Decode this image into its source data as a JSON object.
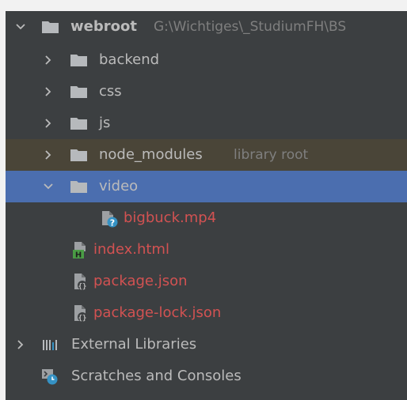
{
  "tree": {
    "root": {
      "name": "webroot",
      "path": "G:\\Wichtiges\\_StudiumFH\\BS",
      "expanded": true,
      "icon": "folder-icon"
    },
    "items": [
      {
        "name": "backend",
        "type": "folder",
        "expanded": false,
        "icon": "folder-icon"
      },
      {
        "name": "css",
        "type": "folder",
        "expanded": false,
        "icon": "folder-icon"
      },
      {
        "name": "js",
        "type": "folder",
        "expanded": false,
        "icon": "folder-icon"
      },
      {
        "name": "node_modules",
        "type": "folder",
        "expanded": false,
        "hint": "library root",
        "icon": "folder-icon"
      },
      {
        "name": "video",
        "type": "folder",
        "expanded": true,
        "selected": true,
        "icon": "folder-icon"
      },
      {
        "name": "bigbuck.mp4",
        "type": "file",
        "icon": "unknown-file-icon",
        "status": "unversioned"
      },
      {
        "name": "index.html",
        "type": "file",
        "icon": "html-file-icon",
        "status": "unversioned"
      },
      {
        "name": "package.json",
        "type": "file",
        "icon": "json-file-icon",
        "status": "unversioned"
      },
      {
        "name": "package-lock.json",
        "type": "file",
        "icon": "json-file-icon",
        "status": "unversioned"
      }
    ],
    "external_libraries": {
      "name": "External Libraries",
      "expanded": false,
      "icon": "libraries-icon"
    },
    "scratches": {
      "name": "Scratches and Consoles",
      "icon": "scratches-icon"
    }
  },
  "colors": {
    "background": "#3c3f41",
    "selection": "#4b6eaf",
    "library_root_row": "#4a4538",
    "text": "#bbbbbb",
    "hint_text": "#7f7f7f",
    "unversioned_text": "#d25252",
    "folder": "#b6b9bc"
  }
}
